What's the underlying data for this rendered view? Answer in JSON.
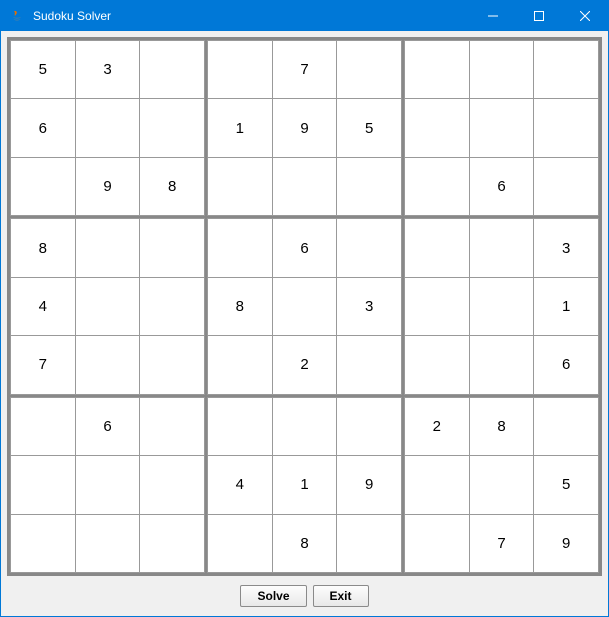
{
  "window": {
    "title": "Sudoku Solver"
  },
  "buttons": {
    "solve": "Solve",
    "exit": "Exit"
  },
  "grid": [
    [
      "5",
      "3",
      "",
      "",
      "7",
      "",
      "",
      "",
      ""
    ],
    [
      "6",
      "",
      "",
      "1",
      "9",
      "5",
      "",
      "",
      ""
    ],
    [
      "",
      "9",
      "8",
      "",
      "",
      "",
      "",
      "6",
      ""
    ],
    [
      "8",
      "",
      "",
      "",
      "6",
      "",
      "",
      "",
      "3"
    ],
    [
      "4",
      "",
      "",
      "8",
      "",
      "3",
      "",
      "",
      "1"
    ],
    [
      "7",
      "",
      "",
      "",
      "2",
      "",
      "",
      "",
      "6"
    ],
    [
      "",
      "6",
      "",
      "",
      "",
      "",
      "2",
      "8",
      ""
    ],
    [
      "",
      "",
      "",
      "4",
      "1",
      "9",
      "",
      "",
      "5"
    ],
    [
      "",
      "",
      "",
      "",
      "8",
      "",
      "",
      "7",
      "9"
    ]
  ]
}
